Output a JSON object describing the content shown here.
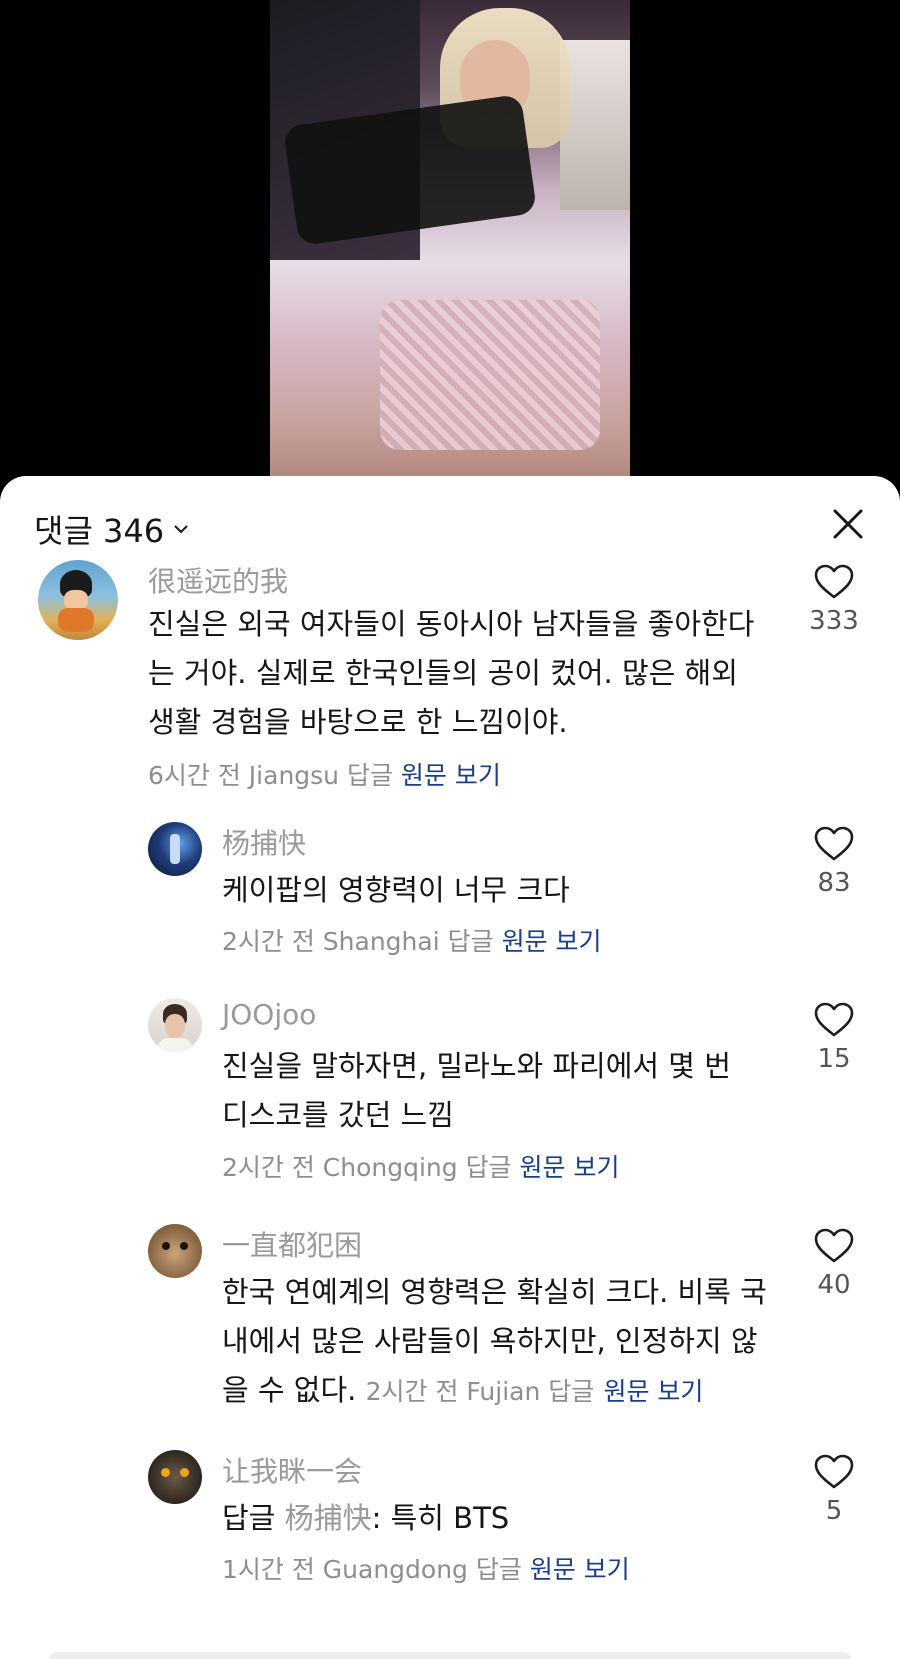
{
  "sheet": {
    "title": "댓글 346"
  },
  "comments": [
    {
      "username": "很遥远的我",
      "text": "진실은 외국 여자들이 동아시아 남자들을 좋아한다는 거야. 실제로 한국인들의 공이 컸어. 많은 해외 생활 경험을 바탕으로 한 느낌이야.",
      "meta": "6시간 전 Jiangsu 답글",
      "link": "원문 보기",
      "likes": "333"
    },
    {
      "username": "杨捕快",
      "text": "케이팝의 영향력이 너무 크다",
      "meta": "2시간 전 Shanghai 답글",
      "link": "원문 보기",
      "likes": "83"
    },
    {
      "username": "JOOjoo",
      "text": "진실을 말하자면, 밀라노와 파리에서 몇 번 디스코를 갔던 느낌",
      "meta": "2시간 전 Chongqing 답글",
      "link": "원문 보기",
      "likes": "15"
    },
    {
      "username": "一直都犯困",
      "text": "한국 연예계의 영향력은 확실히 크다. 비록 국내에서 많은 사람들이 욕하지만, 인정하지 않을 수 없다.",
      "meta": "2시간 전 Fujian 답글",
      "link": "원문 보기",
      "likes": "40"
    },
    {
      "username": "让我眯一会",
      "reply_prefix": "답글",
      "reply_to": "杨捕快",
      "text": ": 특히 BTS",
      "meta": "1시간 전 Guangdong 답글",
      "link": "원문 보기",
      "likes": "5"
    }
  ]
}
